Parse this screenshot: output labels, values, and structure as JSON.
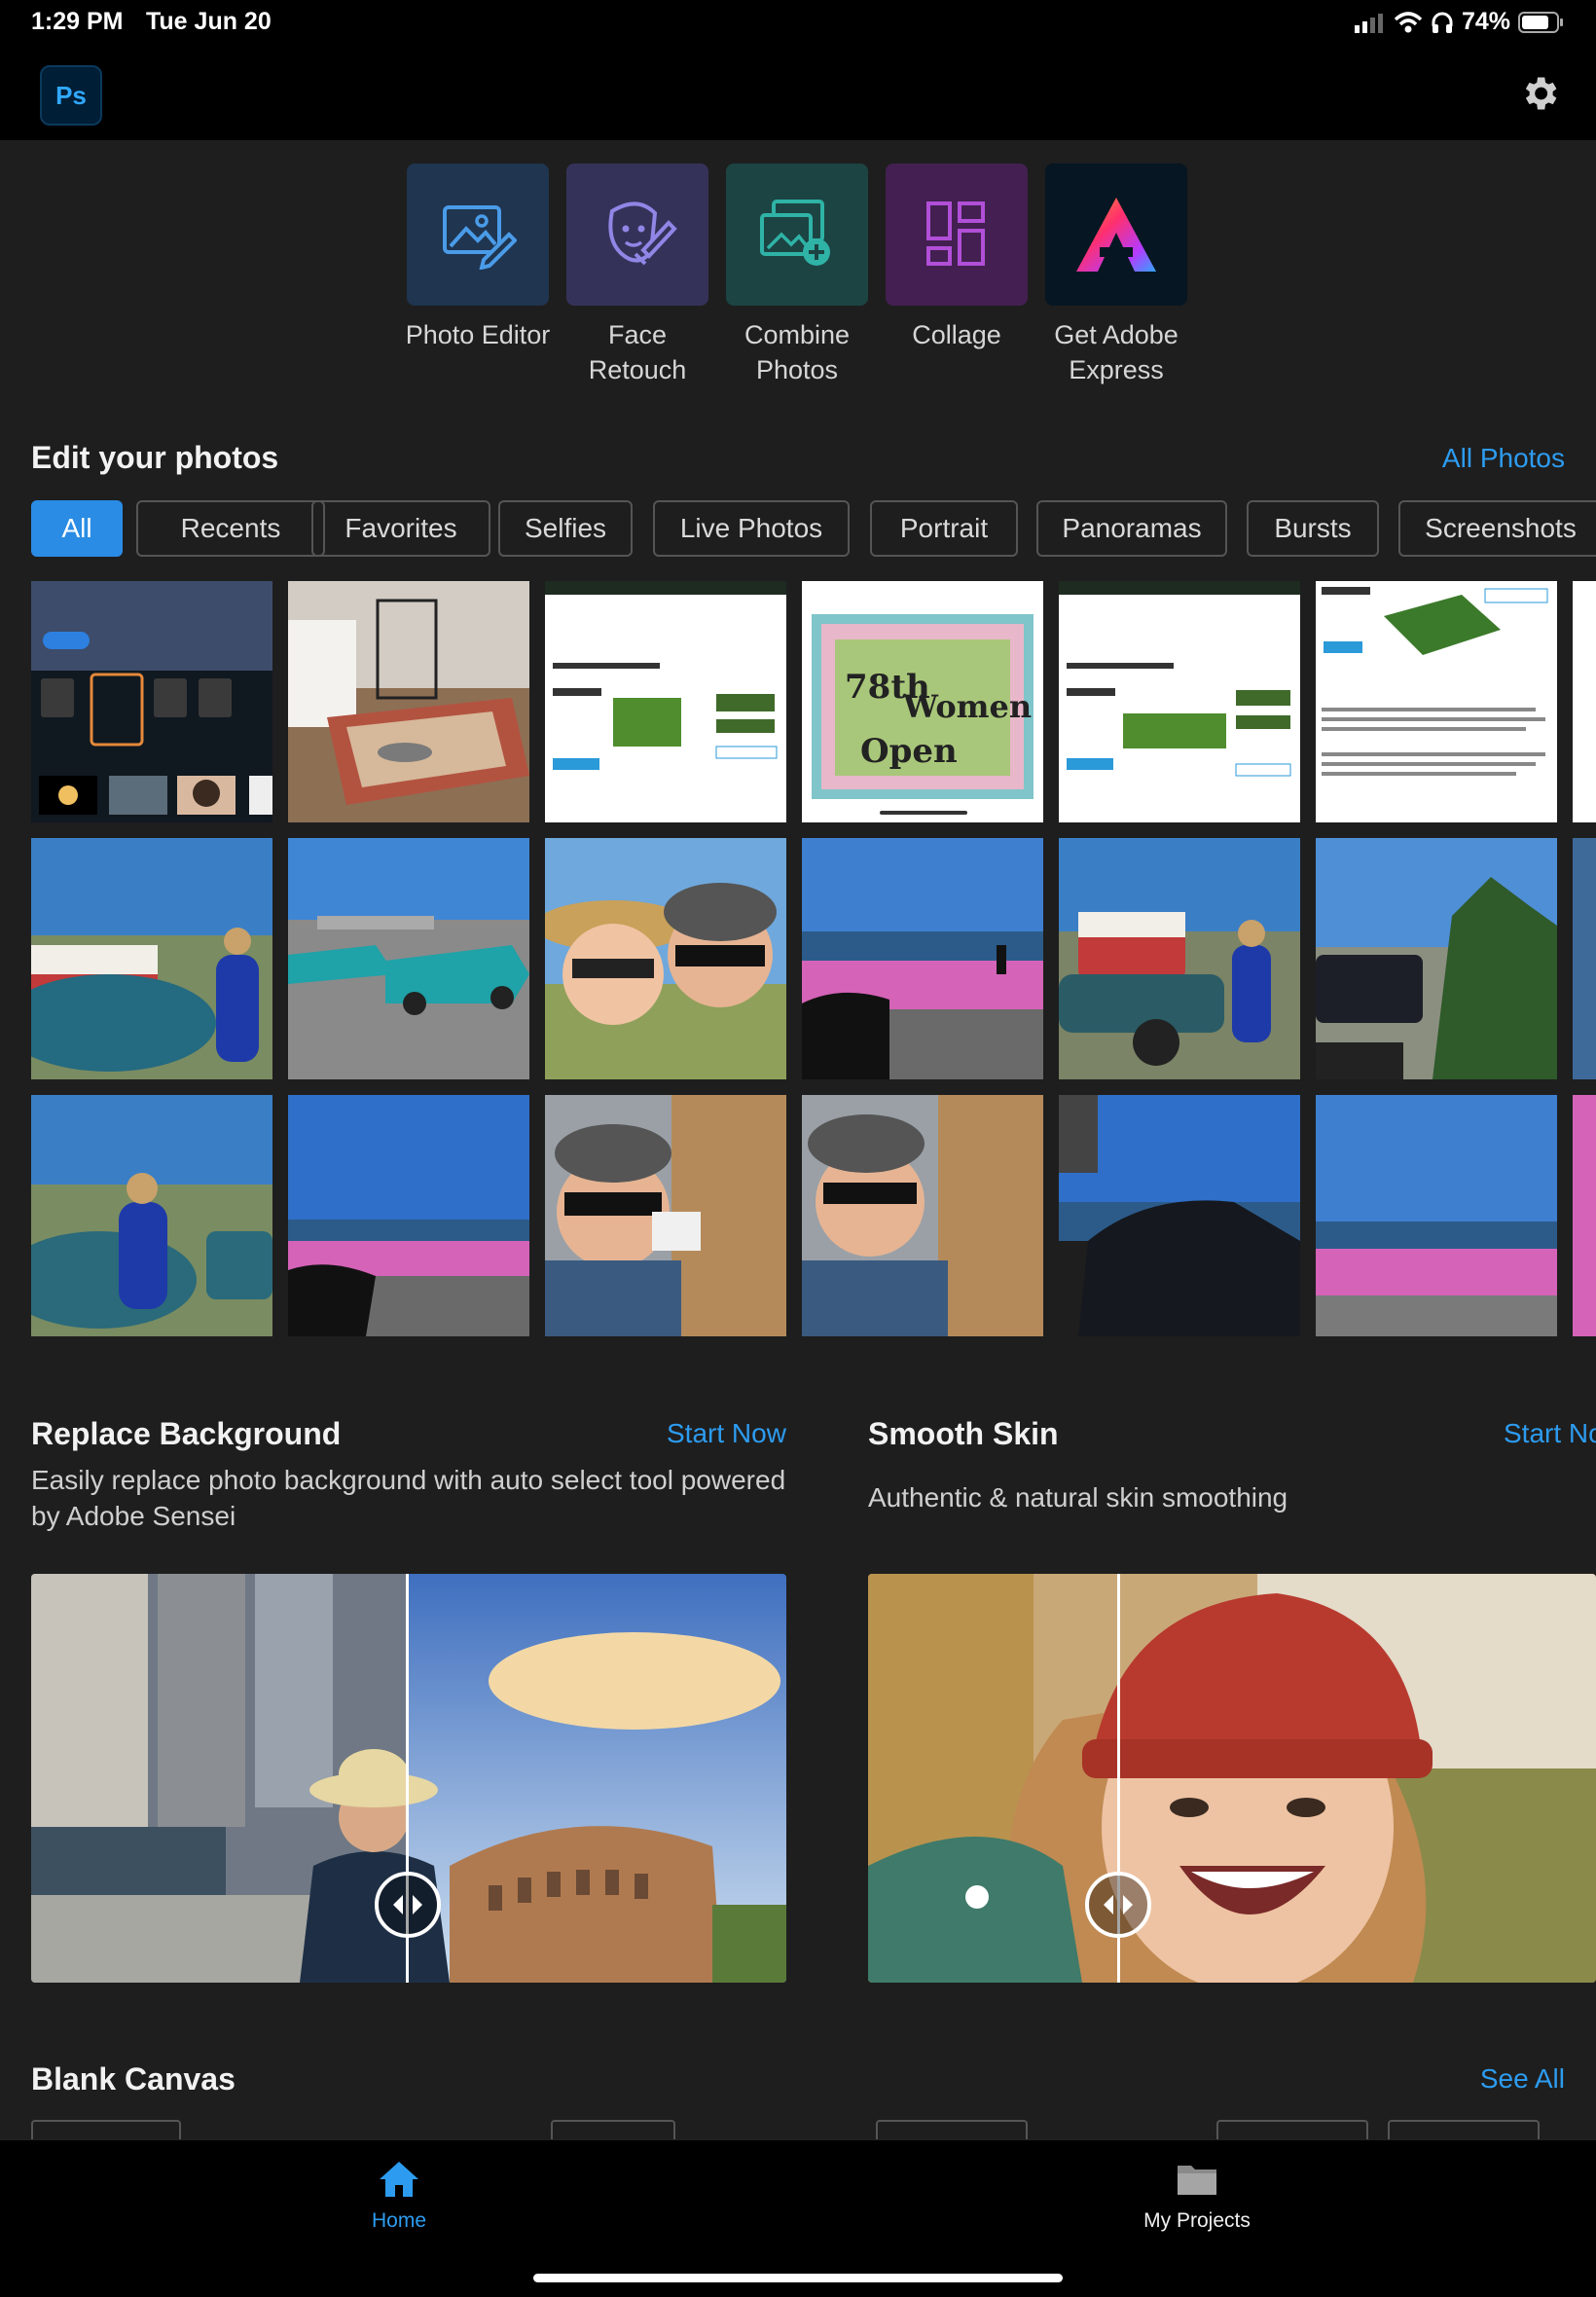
{
  "status_bar": {
    "time": "1:29 PM",
    "date": "Tue Jun 20",
    "battery": "74%"
  },
  "header": {
    "logo_text": "Ps",
    "settings_icon": "gear-icon"
  },
  "quick_actions": [
    {
      "label": "Photo Editor",
      "icon": "photo-edit-icon",
      "bg": "#1f3550",
      "color": "#4a9be8"
    },
    {
      "label": "Face Retouch",
      "icon": "face-retouch-icon",
      "bg": "#35325a",
      "color": "#8f86e6"
    },
    {
      "label": "Combine Photos",
      "icon": "combine-photos-icon",
      "bg": "#1c4443",
      "color": "#2fb3a6"
    },
    {
      "label": "Collage",
      "icon": "collage-icon",
      "bg": "#432051",
      "color": "#b14fd8"
    },
    {
      "label": "Get Adobe Express",
      "icon": "adobe-express-icon",
      "bg": "#061622",
      "color": "#ff3d6a"
    }
  ],
  "edit_photos": {
    "title": "Edit your photos",
    "link": "All Photos",
    "filters": [
      "All",
      "Recents",
      "Favorites",
      "Selfies",
      "Live Photos",
      "Portrait",
      "Panoramas",
      "Bursts",
      "Screenshots"
    ],
    "active_filter": "All"
  },
  "features": [
    {
      "title": "Replace Background",
      "link": "Start Now",
      "description": "Easily replace photo background with auto select tool powered by Adobe Sensei"
    },
    {
      "title": "Smooth Skin",
      "link": "Start Now",
      "description": "Authentic & natural skin smoothing"
    }
  ],
  "blank_canvas": {
    "title": "Blank Canvas",
    "link": "See All"
  },
  "bottom_nav": [
    {
      "label": "Home",
      "icon": "home-icon",
      "active": true
    },
    {
      "label": "My Projects",
      "icon": "folder-icon",
      "active": false
    }
  ],
  "colors": {
    "accent": "#2d9cf0",
    "background": "#1e1e1e",
    "bar": "#000000"
  }
}
